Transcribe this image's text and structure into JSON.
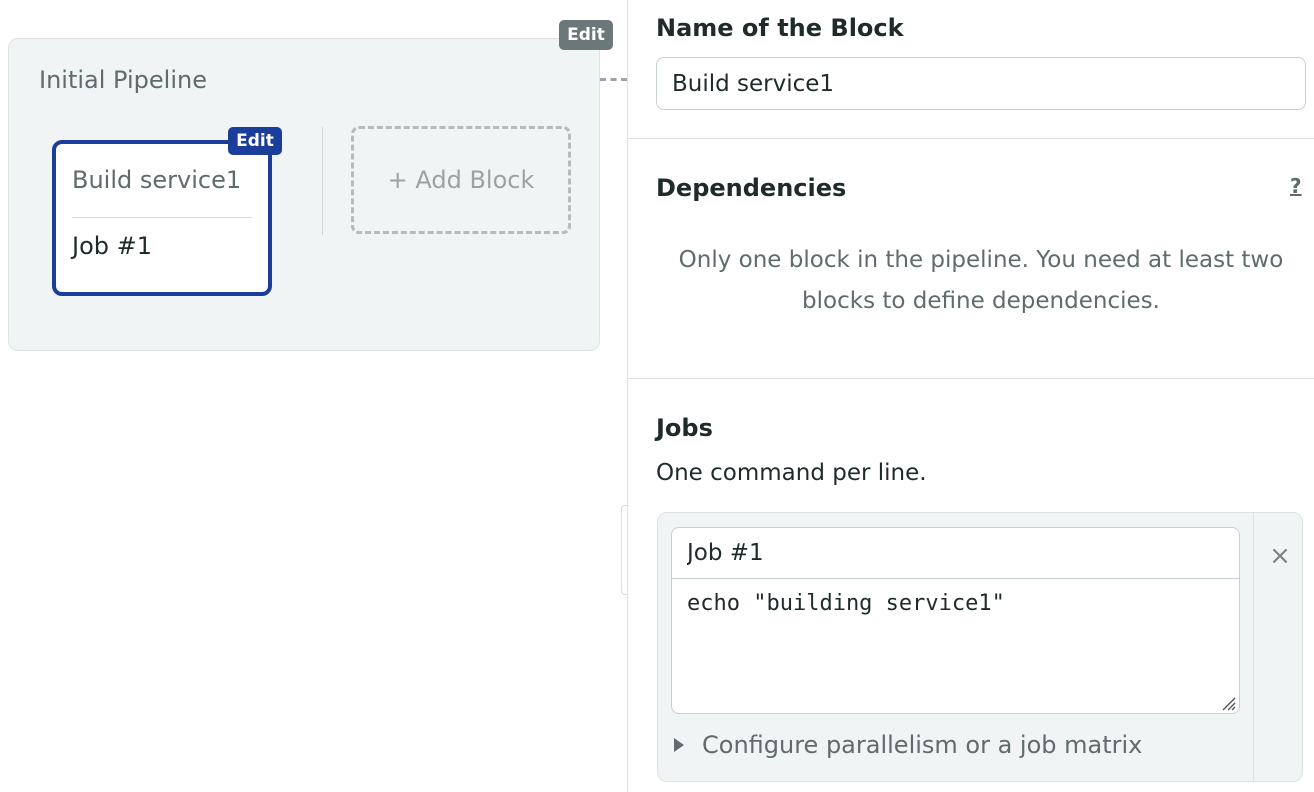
{
  "pipeline": {
    "title": "Initial Pipeline",
    "edit_label": "Edit",
    "block": {
      "name": "Build service1",
      "job": "Job #1",
      "edit_label": "Edit"
    },
    "add_block_label": "+ Add Block"
  },
  "editor": {
    "name_section": {
      "title": "Name of the Block",
      "value": "Build service1"
    },
    "dependencies": {
      "title": "Dependencies",
      "help": "?",
      "message": "Only one block in the pipeline. You need at least two blocks to define dependencies."
    },
    "jobs": {
      "title": "Jobs",
      "subtitle": "One command per line.",
      "items": [
        {
          "name": "Job #1",
          "commands": "echo \"building service1\"",
          "remove_icon": "×"
        }
      ],
      "configure_label": "Configure parallelism or a job matrix"
    }
  },
  "colors": {
    "accent": "#1b3e9a",
    "muted": "#5f6b6c",
    "panel_bg": "#f1f4f5"
  }
}
